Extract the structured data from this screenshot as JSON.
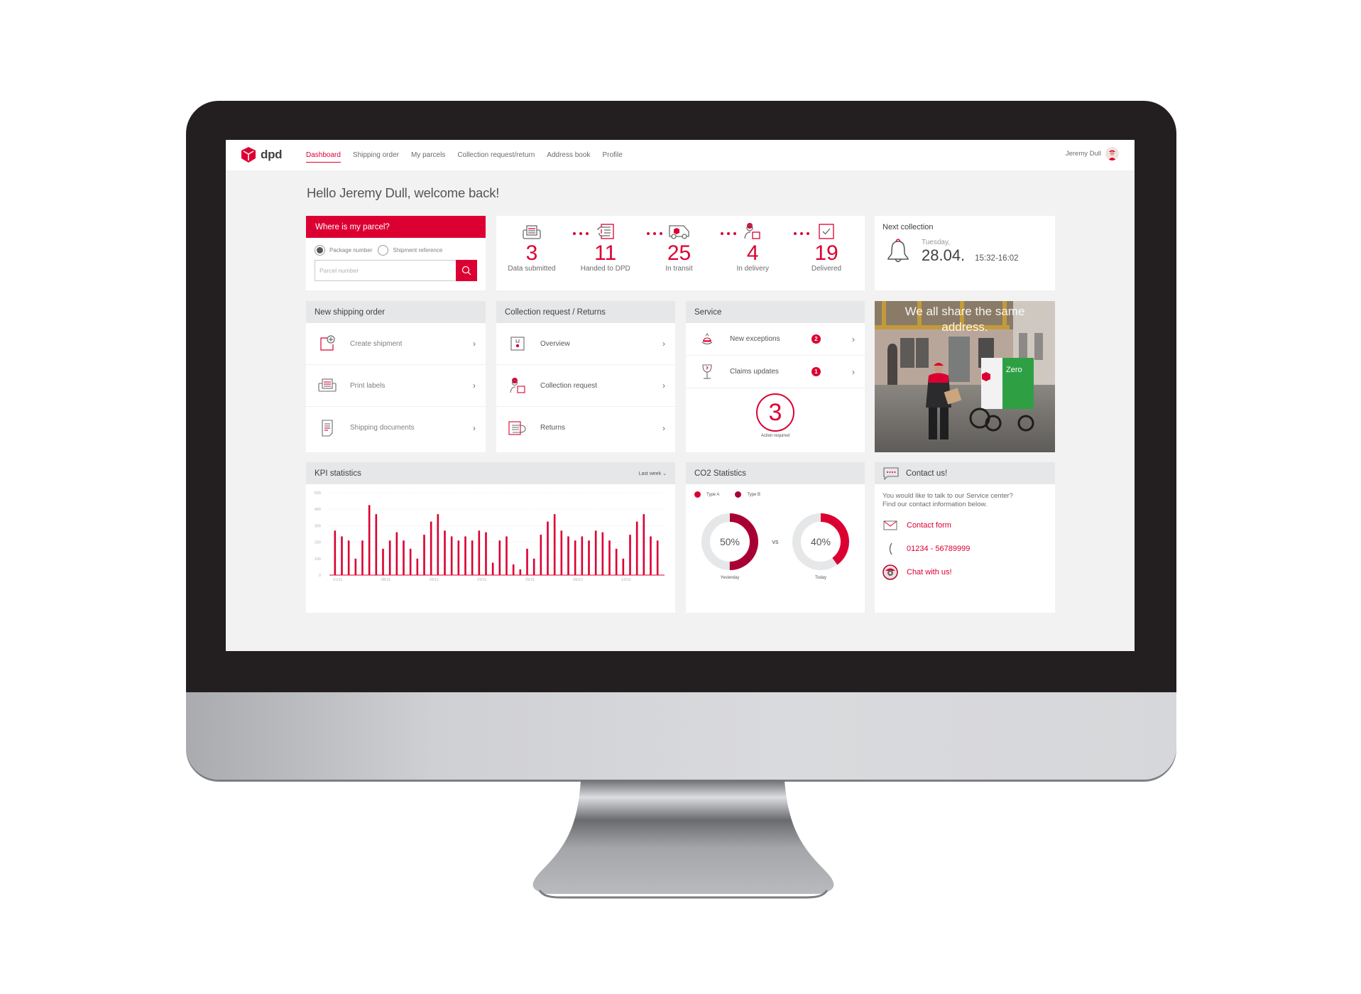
{
  "app": {
    "brand": "dpd",
    "accent_color": "#dc0032",
    "accent_dark_color": "#a90034"
  },
  "nav": {
    "items": [
      {
        "label": "Dashboard",
        "active": true
      },
      {
        "label": "Shipping order",
        "active": false
      },
      {
        "label": "My parcels",
        "active": false
      },
      {
        "label": "Collection request/return",
        "active": false
      },
      {
        "label": "Address book",
        "active": false
      },
      {
        "label": "Profile",
        "active": false
      }
    ],
    "user_name": "Jeremy Dull"
  },
  "greeting": "Hello Jeremy Dull, welcome back!",
  "parcel_search": {
    "title": "Where is my parcel?",
    "options": [
      {
        "label": "Package number",
        "selected": true
      },
      {
        "label": "Shipment reference",
        "selected": false
      }
    ],
    "input_value": "",
    "input_placeholder": "Parcel number",
    "search_icon": "search-icon"
  },
  "tracker": {
    "steps": [
      {
        "count": "3",
        "label": "Data submitted",
        "icon": "printer-icon"
      },
      {
        "count": "11",
        "label": "Handed to DPD",
        "icon": "hand-parcel-icon"
      },
      {
        "count": "25",
        "label": "In transit",
        "icon": "van-icon"
      },
      {
        "count": "4",
        "label": "In delivery",
        "icon": "courier-icon"
      },
      {
        "count": "19",
        "label": "Delivered",
        "icon": "checkbox-icon"
      }
    ]
  },
  "next_collection": {
    "title": "Next collection",
    "day": "Tuesday,",
    "date": "28.04.",
    "time": "15:32-16:02",
    "icon": "bell-icon"
  },
  "shipping_order": {
    "title": "New shipping order",
    "items": [
      {
        "label": "Create shipment",
        "icon": "create-shipment-icon"
      },
      {
        "label": "Print labels",
        "icon": "printer-icon"
      },
      {
        "label": "Shipping documents",
        "icon": "document-icon"
      }
    ]
  },
  "collection_returns": {
    "title": "Collection request / Returns",
    "items": [
      {
        "label": "Overview",
        "icon": "parcel-box-icon"
      },
      {
        "label": "Collection request",
        "icon": "courier-icon"
      },
      {
        "label": "Returns",
        "icon": "return-hand-icon"
      }
    ]
  },
  "service": {
    "title": "Service",
    "items": [
      {
        "label": "New exceptions",
        "badge": "2",
        "icon": "alert-bell-icon"
      },
      {
        "label": "Claims updates",
        "badge": "1",
        "icon": "broken-glass-icon"
      }
    ],
    "action_count": "3",
    "action_label": "Action required"
  },
  "promo": {
    "text_line1": "We all share the same",
    "text_line2": "address.",
    "van_label": "Zero"
  },
  "kpi": {
    "title": "KPI statistics",
    "range_label": "Last week",
    "chart_data": {
      "type": "bar",
      "title": "KPI statistics",
      "xlabel": "",
      "ylabel": "",
      "ylim": [
        0,
        500
      ],
      "yticks": [
        0,
        100,
        200,
        300,
        400,
        500
      ],
      "grid": true,
      "xtick_labels": [
        "01/11",
        "08/11",
        "15/11",
        "22/11",
        "29/11",
        "06/12",
        "13/12"
      ],
      "xtick_positions": [
        0,
        7,
        14,
        21,
        28,
        35,
        42
      ],
      "values": [
        270,
        235,
        210,
        100,
        210,
        425,
        370,
        160,
        210,
        260,
        210,
        160,
        100,
        245,
        325,
        370,
        270,
        235,
        210,
        235,
        210,
        270,
        260,
        75,
        210,
        235,
        65,
        35,
        160,
        100,
        245,
        325,
        370,
        270,
        235,
        210,
        235,
        210,
        270,
        260,
        210,
        160,
        100,
        245,
        325,
        370,
        235,
        210
      ],
      "color": "#dc0032"
    }
  },
  "co2": {
    "title": "CO2 Statistics",
    "chart_data": {
      "type": "pie",
      "legend": [
        {
          "name": "Type A",
          "color": "#dc0032"
        },
        {
          "name": "Type B",
          "color": "#a90034"
        }
      ],
      "legend_position": "top-left",
      "donuts": [
        {
          "caption": "Yesterday",
          "value": 50,
          "label": "50%",
          "color": "#a90034"
        },
        {
          "caption": "Today",
          "value": 40,
          "label": "40%",
          "color": "#dc0032"
        }
      ],
      "separator": "vs"
    }
  },
  "contact": {
    "title": "Contact us!",
    "intro_line1": "You would like to talk to our Service center?",
    "intro_line2": "Find our contact information below.",
    "links": [
      {
        "label": "Contact form",
        "icon": "envelope-icon"
      },
      {
        "label": "01234 - 56789999",
        "icon": "phone-icon"
      },
      {
        "label": "Chat with us!",
        "icon": "chat-avatar-icon"
      }
    ]
  }
}
